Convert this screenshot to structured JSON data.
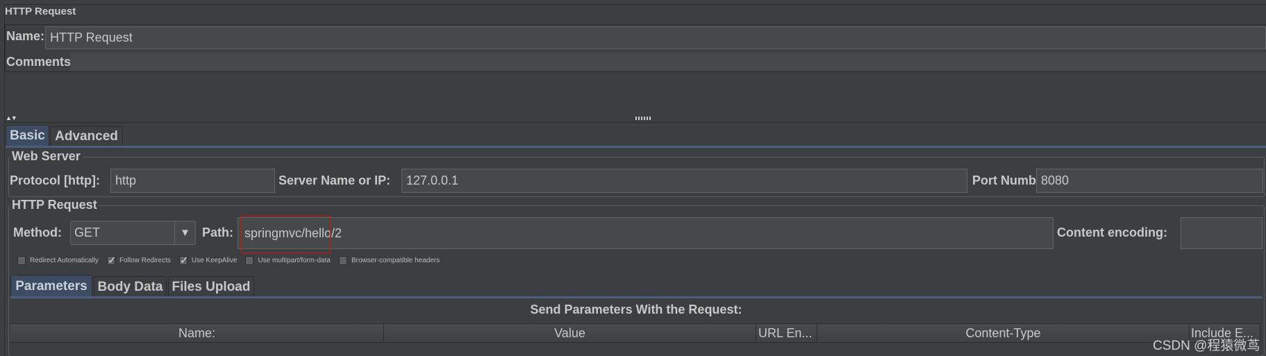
{
  "panel_title": "HTTP Request",
  "name": {
    "label": "Name:",
    "value": "HTTP Request"
  },
  "comments": {
    "label": "Comments:",
    "value": ""
  },
  "splitter": {
    "arrows": "▲▼",
    "grip-icon": "grip-icon"
  },
  "main_tabs": [
    {
      "label": "Basic",
      "selected": true
    },
    {
      "label": "Advanced",
      "selected": false
    }
  ],
  "web_server": {
    "title": "Web Server",
    "protocol": {
      "label": "Protocol [http]:",
      "value": "http"
    },
    "server": {
      "label": "Server Name or IP:",
      "value": "127.0.0.1"
    },
    "port": {
      "label": "Port Number:",
      "value": "8080"
    }
  },
  "http_request": {
    "title": "HTTP Request",
    "method": {
      "label": "Method:",
      "value": "GET",
      "arrow": "▼"
    },
    "path": {
      "label": "Path:",
      "value": "springmvc/hello/2"
    },
    "encoding": {
      "label": "Content encoding:",
      "value": ""
    },
    "checkboxes": [
      {
        "label": "Redirect Automatically",
        "checked": false
      },
      {
        "label": "Follow Redirects",
        "checked": true
      },
      {
        "label": "Use KeepAlive",
        "checked": true
      },
      {
        "label": "Use multipart/form-data",
        "checked": false
      },
      {
        "label": "Browser-compatible headers",
        "checked": false
      }
    ]
  },
  "sub_tabs": [
    {
      "label": "Parameters",
      "selected": true
    },
    {
      "label": "Body Data",
      "selected": false
    },
    {
      "label": "Files Upload",
      "selected": false
    }
  ],
  "params": {
    "title": "Send Parameters With the Request:",
    "columns": [
      "Name:",
      "Value",
      "URL En...",
      "Content-Type",
      "Include E..."
    ]
  },
  "watermark": "CSDN @程猿微茑",
  "colors": {
    "accent": "#4b6eaf",
    "highlight_box": "#e01010",
    "background": "#3c3f41"
  }
}
